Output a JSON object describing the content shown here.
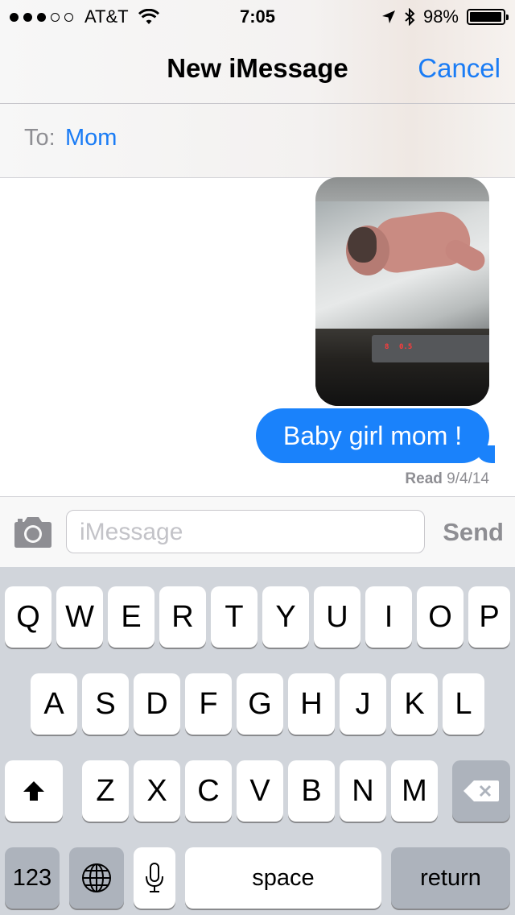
{
  "status_bar": {
    "carrier": "AT&T",
    "time": "7:05",
    "battery_percent": "98%",
    "battery_level": 0.98,
    "signal_bars": 3,
    "signal_total": 5
  },
  "nav": {
    "title": "New iMessage",
    "cancel_label": "Cancel"
  },
  "to_field": {
    "label": "To:",
    "recipient": "Mom"
  },
  "messages": {
    "photo_digits": [
      "8",
      "0.5"
    ],
    "text": "Baby girl mom !",
    "read_label": "Read",
    "read_date": "9/4/14"
  },
  "input_bar": {
    "placeholder": "iMessage",
    "send_label": "Send"
  },
  "keyboard": {
    "row1": [
      "Q",
      "W",
      "E",
      "R",
      "T",
      "Y",
      "U",
      "I",
      "O",
      "P"
    ],
    "row2": [
      "A",
      "S",
      "D",
      "F",
      "G",
      "H",
      "J",
      "K",
      "L"
    ],
    "row3": [
      "Z",
      "X",
      "C",
      "V",
      "B",
      "N",
      "M"
    ],
    "numbers_label": "123",
    "space_label": "space",
    "return_label": "return"
  },
  "colors": {
    "accent": "#1a7cf5",
    "bubble": "#1a82fb",
    "keyboard_bg": "#d1d5db"
  }
}
